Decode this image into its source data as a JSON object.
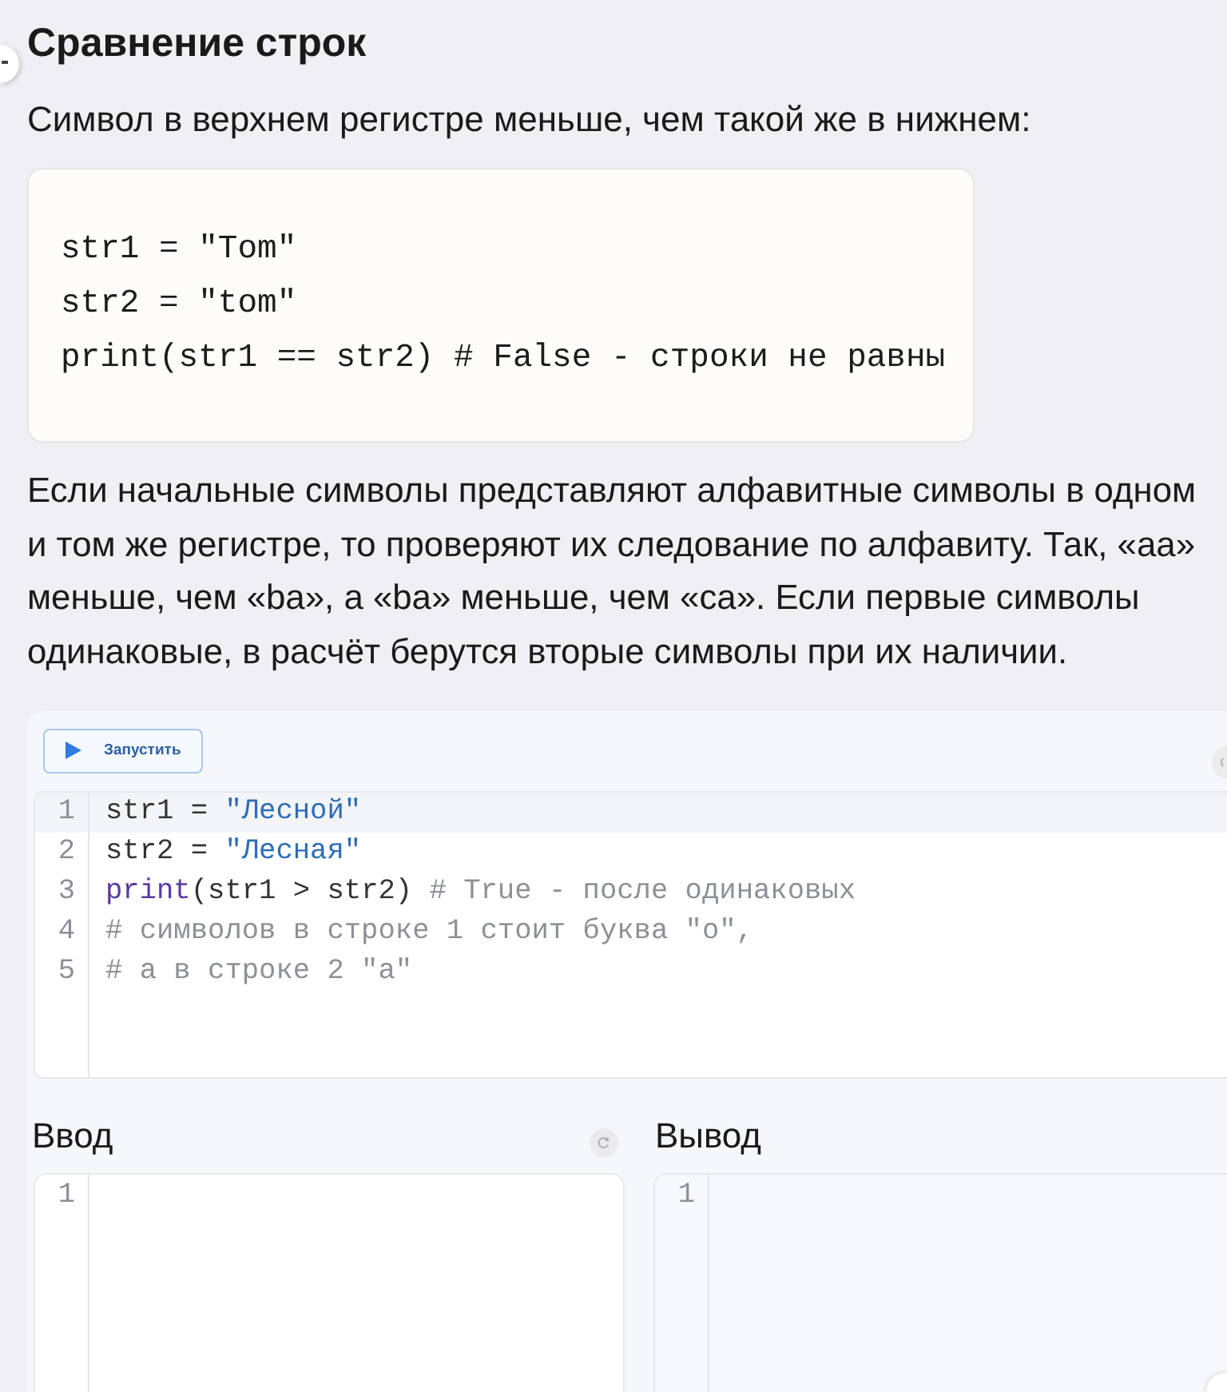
{
  "article": {
    "title": "Сравнение строк",
    "intro": "Символ в верхнем регистре меньше, чем такой же в нижнем:",
    "example_code": [
      "str1 = \"Tom\"",
      "str2 = \"tom\"",
      "print(str1 == str2) # False - строки не равны"
    ],
    "paragraph": "Если начальные символы представляют алфавитные символы в одном и том же регистре, то проверяют их следование по алфавиту. Так, «aa» меньше, чем «ba», а «ba» меньше, чем «ca». Если первые символы одинаковые, в расчёт берутся вторые символы при их наличии."
  },
  "code_runner": {
    "run_button": "Запустить",
    "editor": {
      "lines": [
        {
          "number": "1",
          "active": true,
          "tokens": [
            {
              "kind": "plain",
              "text": "str1 = "
            },
            {
              "kind": "string",
              "text": "\"Лесной\""
            }
          ]
        },
        {
          "number": "2",
          "active": false,
          "tokens": [
            {
              "kind": "plain",
              "text": "str2 = "
            },
            {
              "kind": "string",
              "text": "\"Лесная\""
            }
          ]
        },
        {
          "number": "3",
          "active": false,
          "tokens": [
            {
              "kind": "builtin",
              "text": "print"
            },
            {
              "kind": "plain",
              "text": "(str1 > str2) "
            },
            {
              "kind": "comment",
              "text": "# True - после одинаковых"
            }
          ]
        },
        {
          "number": "4",
          "active": false,
          "tokens": [
            {
              "kind": "comment",
              "text": "# символов в строке 1 стоит буква \"о\","
            }
          ]
        },
        {
          "number": "5",
          "active": false,
          "tokens": [
            {
              "kind": "comment",
              "text": "# а в строке 2 \"а\""
            }
          ]
        }
      ]
    },
    "input": {
      "label": "Ввод",
      "line_numbers": [
        "1"
      ]
    },
    "output": {
      "label": "Вывод",
      "line_numbers": [
        "1"
      ]
    }
  }
}
